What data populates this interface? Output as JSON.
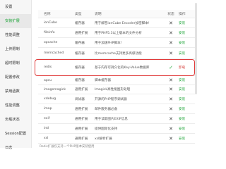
{
  "sidebar": {
    "items": [
      {
        "label": "设置"
      },
      {
        "label": "安装扩展"
      },
      {
        "label": "性能调整"
      },
      {
        "label": "上传限制"
      },
      {
        "label": "超时限制"
      },
      {
        "label": "配置修改"
      },
      {
        "label": "禁用函数"
      },
      {
        "label": "性能调整"
      },
      {
        "label": "负载状态"
      },
      {
        "label": "Session配置"
      },
      {
        "label": "日志"
      }
    ]
  },
  "table": {
    "headers": [
      "名称",
      "类型",
      "说明",
      "状态",
      "操作"
    ],
    "rows": [
      {
        "name": "ionCube",
        "type": "缓存器",
        "desc": "用于解密ionCube Encoder加密脚本!",
        "status": "✕",
        "action": "安装"
      },
      {
        "name": "fileinfo",
        "type": "通用扩展",
        "desc": "用于PHP5.3以上版本的文件分析",
        "status": "✕",
        "action": "安装"
      },
      {
        "name": "opcache",
        "type": "缓存器",
        "desc": "用于加速PHP脚本!",
        "status": "✕",
        "action": "安装"
      },
      {
        "name": "memcached",
        "type": "缓存器",
        "desc": "比memcache支持更多高级功能",
        "status": "✕",
        "action": "安装"
      },
      {
        "name": "redis",
        "type": "缓存器",
        "desc": "基于内存可持久化的Key-Value数据库",
        "status": "✓",
        "action": "卸载"
      },
      {
        "name": "apcu",
        "type": "缓存器",
        "desc": "脚本缓存器",
        "status": "✕",
        "action": "安装"
      },
      {
        "name": "imagemagick",
        "type": "通用扩展",
        "desc": "Imagick高性能图形处理",
        "status": "✕",
        "action": "安装"
      },
      {
        "name": "xdebug",
        "type": "调试器",
        "desc": "开源的PHP程序调试器",
        "status": "✕",
        "action": "安装"
      },
      {
        "name": "imap",
        "type": "通用扩展",
        "desc": "邮件服务器必备",
        "status": "✕",
        "action": "安装"
      },
      {
        "name": "exif",
        "type": "通用扩展",
        "desc": "用于读取图片EXIF信息",
        "status": "✕",
        "action": "安装"
      },
      {
        "name": "intl",
        "type": "通用扩展",
        "desc": "提供国际化支持",
        "status": "✕",
        "action": "安装"
      },
      {
        "name": "xsl",
        "type": "通用扩展",
        "desc": "xsl解析扩展",
        "status": "✕",
        "action": "安装"
      }
    ]
  },
  "footer": "Redis扩展仅支持一个PHP版本安装使用"
}
